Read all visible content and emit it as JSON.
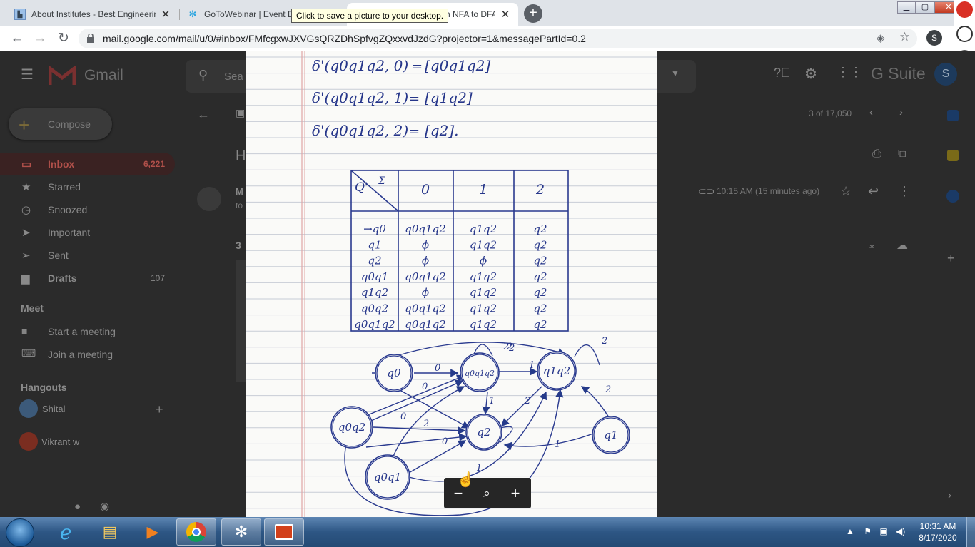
{
  "browser": {
    "tabs": [
      {
        "title": "About Institutes - Best Engineerin",
        "icon": "institute-favicon",
        "active": false
      },
      {
        "title": "GoToWebinar | Event D",
        "icon": "gotowebinar-favicon",
        "active": false
      },
      {
        "title": "n NFA to DFA",
        "icon": "gmail-favicon",
        "active": true
      }
    ],
    "tooltip": "Click to save a picture to your desktop.",
    "url": "mail.google.com/mail/u/0/#inbox/FMfcgxwJXVGsQRZDhSpfvgZQxxvdJzdG?projector=1&messagePartId=0.2",
    "profile_initial": "S"
  },
  "gmail": {
    "app_name": "Gmail",
    "search_placeholder": "Sea",
    "compose_label": "Compose",
    "nav": [
      {
        "label": "Inbox",
        "count": "6,221",
        "icon": "inbox-icon"
      },
      {
        "label": "Starred",
        "count": "",
        "icon": "star-icon"
      },
      {
        "label": "Snoozed",
        "count": "",
        "icon": "clock-icon"
      },
      {
        "label": "Important",
        "count": "",
        "icon": "important-icon"
      },
      {
        "label": "Sent",
        "count": "",
        "icon": "send-icon"
      },
      {
        "label": "Drafts",
        "count": "107",
        "icon": "draft-icon"
      }
    ],
    "meet": {
      "title": "Meet",
      "items": [
        "Start a meeting",
        "Join a meeting"
      ]
    },
    "hangouts": {
      "title": "Hangouts",
      "user": "Shital",
      "contact": "Vikrant w"
    },
    "pagination": "3 of 17,050",
    "subject_initial": "H",
    "sender_initial": "M",
    "to_initial": "to",
    "time": "10:15 AM (15 minutes ago)",
    "attachments_count": "3",
    "gsuite": "G Suite",
    "avatar_initial": "S"
  },
  "attachment": {
    "transitions": [
      {
        "lhs": "δ'(q0q1q2, 0)",
        "rhs": "[q0q1q2]"
      },
      {
        "lhs": "δ'(q0q1q2, 1)",
        "rhs": "[q1q2]"
      },
      {
        "lhs": "δ'(q0q1q2, 2)",
        "rhs": "[q2]."
      }
    ],
    "table": {
      "corner_q": "Q'",
      "corner_sigma": "Σ",
      "headers": [
        "0",
        "1",
        "2"
      ],
      "rows": [
        [
          "→q0",
          "q0q1q2",
          "q1q2",
          "q2"
        ],
        [
          "q1",
          "ϕ",
          "q1q2",
          "q2"
        ],
        [
          "q2",
          "ϕ",
          "ϕ",
          "q2"
        ],
        [
          "q0q1",
          "q0q1q2",
          "q1q2",
          "q2"
        ],
        [
          "q1q2",
          "ϕ",
          "q1q2",
          "q2"
        ],
        [
          "q0q2",
          "q0q1q2",
          "q1q2",
          "q2"
        ],
        [
          "q0q1q2",
          "q0q1q2",
          "q1q2",
          "q2"
        ]
      ]
    },
    "diagram": {
      "states": [
        "q0",
        "q0q1q2",
        "q1q2",
        "q0q2",
        "q2",
        "q1",
        "q0q1"
      ],
      "edge_labels": [
        "0",
        "1",
        "0",
        "1",
        "2",
        "0",
        "2",
        "0",
        "2",
        "2",
        "2",
        "1",
        "2",
        "1",
        "2"
      ]
    }
  },
  "zoom": {
    "minus": "−",
    "magnify": "🔍",
    "plus": "+"
  },
  "taskbar": {
    "time": "10:31 AM",
    "date": "8/17/2020"
  }
}
